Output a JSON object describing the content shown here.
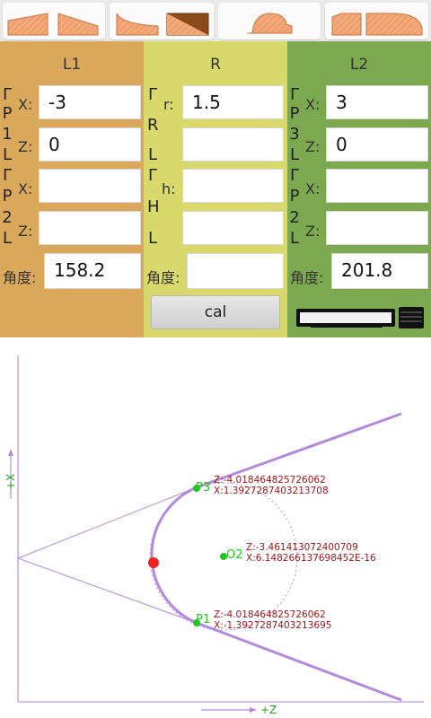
{
  "colors": {
    "l1_panel": "#d9a85a",
    "r_panel": "#d8d96a",
    "l2_panel": "#7ca84f",
    "shape_fill": "#f4a97a",
    "shape_dark": "#8b4a1c",
    "curve": "#b28ad8",
    "point": "#22c322",
    "label_red": "#9b1414",
    "red_dot": "#ee2222",
    "axis": "#c7a6ee"
  },
  "tabs": [
    {
      "icon": "straight-taper-shapes-icon"
    },
    {
      "icon": "inner-corner-shapes-icon"
    },
    {
      "icon": "arc-bump-shape-icon"
    },
    {
      "icon": "step-arc-shapes-icon"
    }
  ],
  "l1": {
    "title": "L1",
    "p_bracket": [
      "Γ",
      "P",
      "1",
      "L"
    ],
    "p2_bracket": [
      "Γ",
      "P",
      "2",
      "L"
    ],
    "x1_label": "X:",
    "z1_label": "Z:",
    "x2_label": "X:",
    "z2_label": "Z:",
    "x1": "-3",
    "z1": "0",
    "x2": "",
    "z2": "",
    "angle_label": "角度:",
    "angle": "158.2"
  },
  "r": {
    "title": "R",
    "r_bracket": [
      "Γ",
      "R",
      "L"
    ],
    "h_bracket": [
      "Γ",
      "H",
      "L"
    ],
    "r_label": "r:",
    "h_label": "h:",
    "r_value": "1.5",
    "r_value2": "",
    "h_value": "",
    "h_value2": "",
    "angle_label": "角度:",
    "angle": "",
    "cal_label": "cal"
  },
  "l2": {
    "title": "L2",
    "p3_bracket": [
      "Γ",
      "P",
      "3",
      "L"
    ],
    "p2_bracket": [
      "Γ",
      "P",
      "2",
      "L"
    ],
    "x1_label": "X:",
    "z1_label": "Z:",
    "x2_label": "X:",
    "z2_label": "Z:",
    "x1": "3",
    "z1": "0",
    "x2": "",
    "z2": "",
    "angle_label": "角度:",
    "angle": "201.8",
    "device_icon": "monitor-keyboard-icon"
  },
  "graph": {
    "x_axis_label": "+X",
    "z_axis_label": "+Z",
    "p3": {
      "name": "P3",
      "z": "Z:-4.018464825726062",
      "x": "X:1.3927287403213708"
    },
    "o2": {
      "name": "O2",
      "z": "Z:-3.461413072400709",
      "x": "X:6.148266137698452E-16"
    },
    "p1": {
      "name": "P1",
      "z": "Z:-4.018464825726062",
      "x": "X:-1.3927287403213695"
    }
  }
}
